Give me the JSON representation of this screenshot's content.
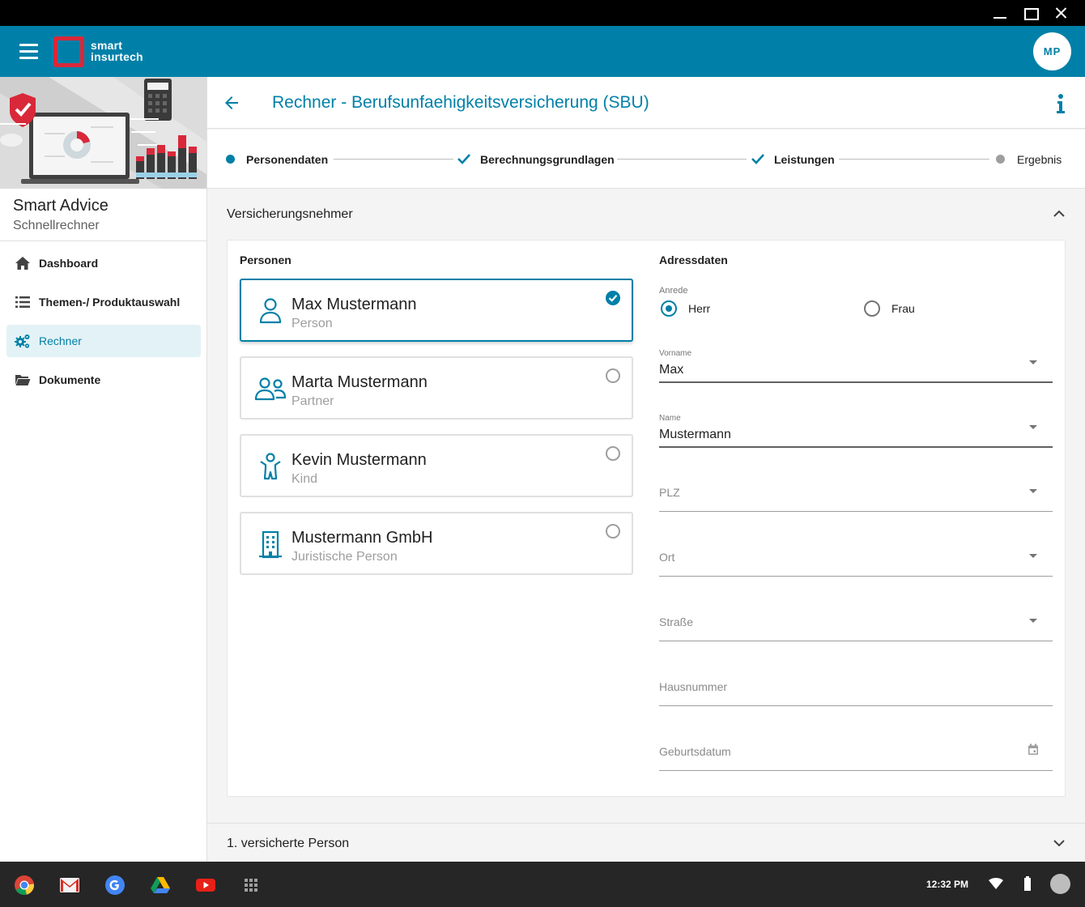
{
  "app": {
    "logo_line1": "smart",
    "logo_line2": "insurtech",
    "avatar_initials": "MP",
    "accent": "#0080a8",
    "brand_red": "#d9283a"
  },
  "sidebar": {
    "title": "Smart Advice",
    "subtitle": "Schnellrechner",
    "items": [
      {
        "label": "Dashboard",
        "icon": "home-icon"
      },
      {
        "label": "Themen-/ Produktauswahl",
        "icon": "list-icon"
      },
      {
        "label": "Rechner",
        "icon": "gears-icon",
        "active": true
      },
      {
        "label": "Dokumente",
        "icon": "folder-icon"
      }
    ]
  },
  "header": {
    "title": "Rechner - Berufsunfaehigkeitsversicherung (SBU)"
  },
  "stepper": {
    "steps": [
      {
        "label": "Personendaten",
        "state": "current"
      },
      {
        "label": "Berechnungsgrundlagen",
        "state": "done"
      },
      {
        "label": "Leistungen",
        "state": "done"
      },
      {
        "label": "Ergebnis",
        "state": "pending"
      }
    ]
  },
  "section": {
    "title": "Versicherungsnehmer",
    "persons_heading": "Personen",
    "address_heading": "Adressdaten",
    "persons": [
      {
        "name": "Max Mustermann",
        "role": "Person",
        "icon": "person-icon",
        "selected": true
      },
      {
        "name": "Marta Mustermann",
        "role": "Partner",
        "icon": "partner-icon",
        "selected": false
      },
      {
        "name": "Kevin Mustermann",
        "role": "Kind",
        "icon": "child-icon",
        "selected": false
      },
      {
        "name": "Mustermann GmbH",
        "role": "Juristische Person",
        "icon": "building-icon",
        "selected": false
      }
    ],
    "anrede": {
      "label": "Anrede",
      "options": [
        "Herr",
        "Frau"
      ],
      "selected": "Herr"
    },
    "fields": {
      "vorname": {
        "label": "Vorname",
        "value": "Max"
      },
      "name": {
        "label": "Name",
        "value": "Mustermann"
      },
      "plz": {
        "placeholder": "PLZ"
      },
      "ort": {
        "placeholder": "Ort"
      },
      "strasse": {
        "placeholder": "Straße"
      },
      "hausnummer": {
        "placeholder": "Hausnummer"
      },
      "geburtsdatum": {
        "placeholder": "Geburtsdatum"
      }
    }
  },
  "section2": {
    "title": "1. versicherte Person"
  },
  "taskbar": {
    "apps": [
      "chrome-icon",
      "gmail-icon",
      "google-search-icon",
      "drive-icon",
      "youtube-icon",
      "launcher-icon"
    ],
    "time": "12:32 PM"
  }
}
